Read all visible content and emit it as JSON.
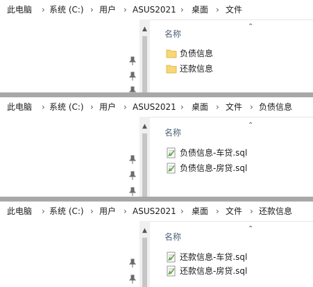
{
  "panel1": {
    "breadcrumb": [
      "此电脑",
      "系统 (C:)",
      "用户",
      "ASUS2021",
      "桌面",
      "文件"
    ],
    "column_header": "名称",
    "items": [
      {
        "name": "负债信息",
        "icon": "folder-icon"
      },
      {
        "name": "还款信息",
        "icon": "folder-icon"
      }
    ]
  },
  "panel2": {
    "breadcrumb": [
      "此电脑",
      "系统 (C:)",
      "用户",
      "ASUS2021",
      "桌面",
      "文件",
      "负债信息"
    ],
    "column_header": "名称",
    "items": [
      {
        "name": "负债信息-车贷.sql",
        "icon": "sql-file-icon"
      },
      {
        "name": "负债信息-房贷.sql",
        "icon": "sql-file-icon"
      }
    ]
  },
  "panel3": {
    "breadcrumb": [
      "此电脑",
      "系统 (C:)",
      "用户",
      "ASUS2021",
      "桌面",
      "文件",
      "还款信息"
    ],
    "column_header": "名称",
    "items": [
      {
        "name": "还款信息-车贷.sql",
        "icon": "sql-file-icon"
      },
      {
        "name": "还款信息-房贷.sql",
        "icon": "sql-file-icon"
      }
    ]
  },
  "colors": {
    "separator": "#a8a8a8",
    "header_text": "#4c607a",
    "folder": "#f8d775",
    "scrollbar_track": "#f0f0f0",
    "scrollbar_thumb": "#c6c6c6"
  }
}
